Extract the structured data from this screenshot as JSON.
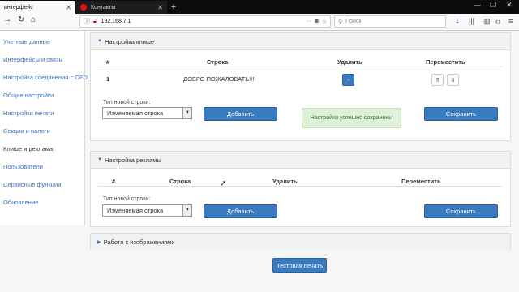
{
  "browser": {
    "tabs": [
      {
        "title": "интерфейс",
        "active": true
      },
      {
        "title": "Контакты",
        "active": false
      }
    ],
    "url": "192.168.7.1",
    "search_placeholder": "Поиск",
    "window_controls": [
      "—",
      "❐",
      "✕"
    ]
  },
  "sidebar": {
    "items": [
      {
        "label": "Учетные данные"
      },
      {
        "label": "Интерфейсы и связь"
      },
      {
        "label": "Настройка соединения с OFD"
      },
      {
        "label": "Общие настройки"
      },
      {
        "label": "Настройки печати"
      },
      {
        "label": "Секции и налоги"
      },
      {
        "label": "Клише и реклама",
        "active": true
      },
      {
        "label": "Пользователи"
      },
      {
        "label": "Сервисные функции"
      },
      {
        "label": "Обновление"
      }
    ]
  },
  "cliche": {
    "title": "Настройка клише",
    "columns": {
      "num": "#",
      "row": "Строка",
      "delete": "Удалить",
      "move": "Переместить"
    },
    "rows": [
      {
        "num": "1",
        "text": "ДОБРО ПОЖАЛОВАТЬ!!!",
        "delete_label": "-"
      }
    ],
    "new_row_type_label": "Тип новой строки:",
    "new_row_type_value": "Изменяемая строка",
    "add_label": "Добавить",
    "success_message": "Настройки успешно сохранены",
    "save_label": "Сохранить"
  },
  "ads": {
    "title": "Настройка рекламы",
    "columns": {
      "num": "#",
      "row": "Строка",
      "delete": "Удалить",
      "move": "Переместить"
    },
    "new_row_type_label": "Тип новой строки:",
    "new_row_type_value": "Изменяемая строка",
    "add_label": "Добавить",
    "save_label": "Сохранить"
  },
  "images": {
    "title": "Работа с изображениями"
  },
  "test_print_label": "Тестовая печать",
  "colors": {
    "accent": "#3a7abf",
    "link": "#3b73b9",
    "success_bg": "#dff0d8",
    "success_text": "#3c763d"
  }
}
